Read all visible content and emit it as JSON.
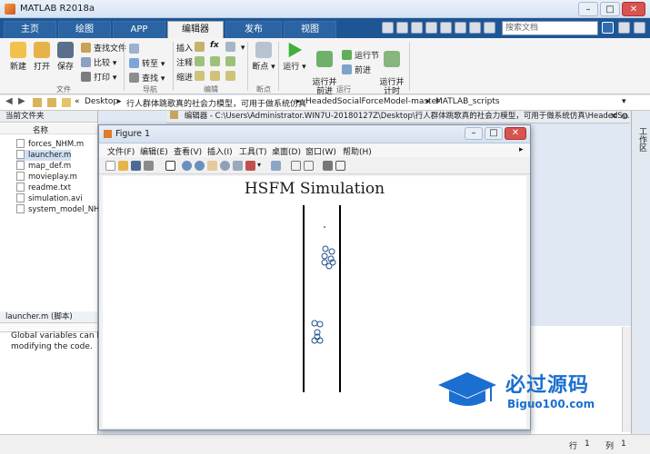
{
  "window": {
    "title": "MATLAB R2018a"
  },
  "ribbon_tabs": [
    "主页",
    "绘图",
    "APP",
    "编辑器",
    "发布",
    "视图"
  ],
  "search": {
    "placeholder": "搜索文档"
  },
  "toolstrip": {
    "file_group": {
      "label": "文件",
      "new": "新建",
      "open": "打开",
      "save": "保存",
      "find_files": "查找文件",
      "compare": "比较",
      "print": "打印"
    },
    "nav_group": {
      "label": "导航",
      "goto": "转至",
      "find": "查找"
    },
    "edit_group": {
      "label": "编辑",
      "insert": "插入",
      "comment": "注释",
      "indent": "缩进",
      "fx": "fx"
    },
    "breakpoint_group": {
      "label": "断点",
      "breakpoints": "断点"
    },
    "run_group": {
      "label": "运行",
      "run": "运行",
      "run_advance": "运行并\n前进",
      "run_section": "运行节",
      "advance": "前进",
      "run_time": "运行并\n计时"
    }
  },
  "address_bar": {
    "crumbs": [
      "«",
      "Desktop",
      "行人群体跳歌真的社会力模型，可用于做系统仿真",
      "HeadedSocialForceModel-master",
      "MATLAB_scripts"
    ]
  },
  "current_folder": {
    "header": "当前文件夹",
    "column": "名称",
    "files": [
      "forces_NHM.m",
      "launcher.m",
      "map_def.m",
      "movieplay.m",
      "readme.txt",
      "simulation.avi",
      "system_model_NHM"
    ],
    "selected": "launcher.m"
  },
  "details": {
    "header": "launcher.m  (脚本)",
    "text_line1": "Global variables can be a",
    "text_line2": "modifying the code."
  },
  "editor_header": "编辑器 - C:\\Users\\Administrator.WIN7U-20180127Z\\Desktop\\行人群体跳歌真的社会力模型，可用于做系统仿真\\HeadedSo...",
  "right_strip": "工作区",
  "figure": {
    "title": "Figure 1",
    "menus": [
      "文件(F)",
      "编辑(E)",
      "查看(V)",
      "插入(I)",
      "工具(T)",
      "桌面(D)",
      "窗口(W)",
      "帮助(H)"
    ],
    "plot_title": "HSFM Simulation"
  },
  "status": {
    "row_label": "行",
    "row": "1",
    "col_label": "列",
    "col": "1"
  },
  "watermark": {
    "text_main": "必过源码",
    "text_sub": "Biguo100.com"
  },
  "colors": {
    "accent": "#1d5694",
    "ribbon_active": "#f2f2f2",
    "watermark_blue": "#1a6fd0"
  }
}
